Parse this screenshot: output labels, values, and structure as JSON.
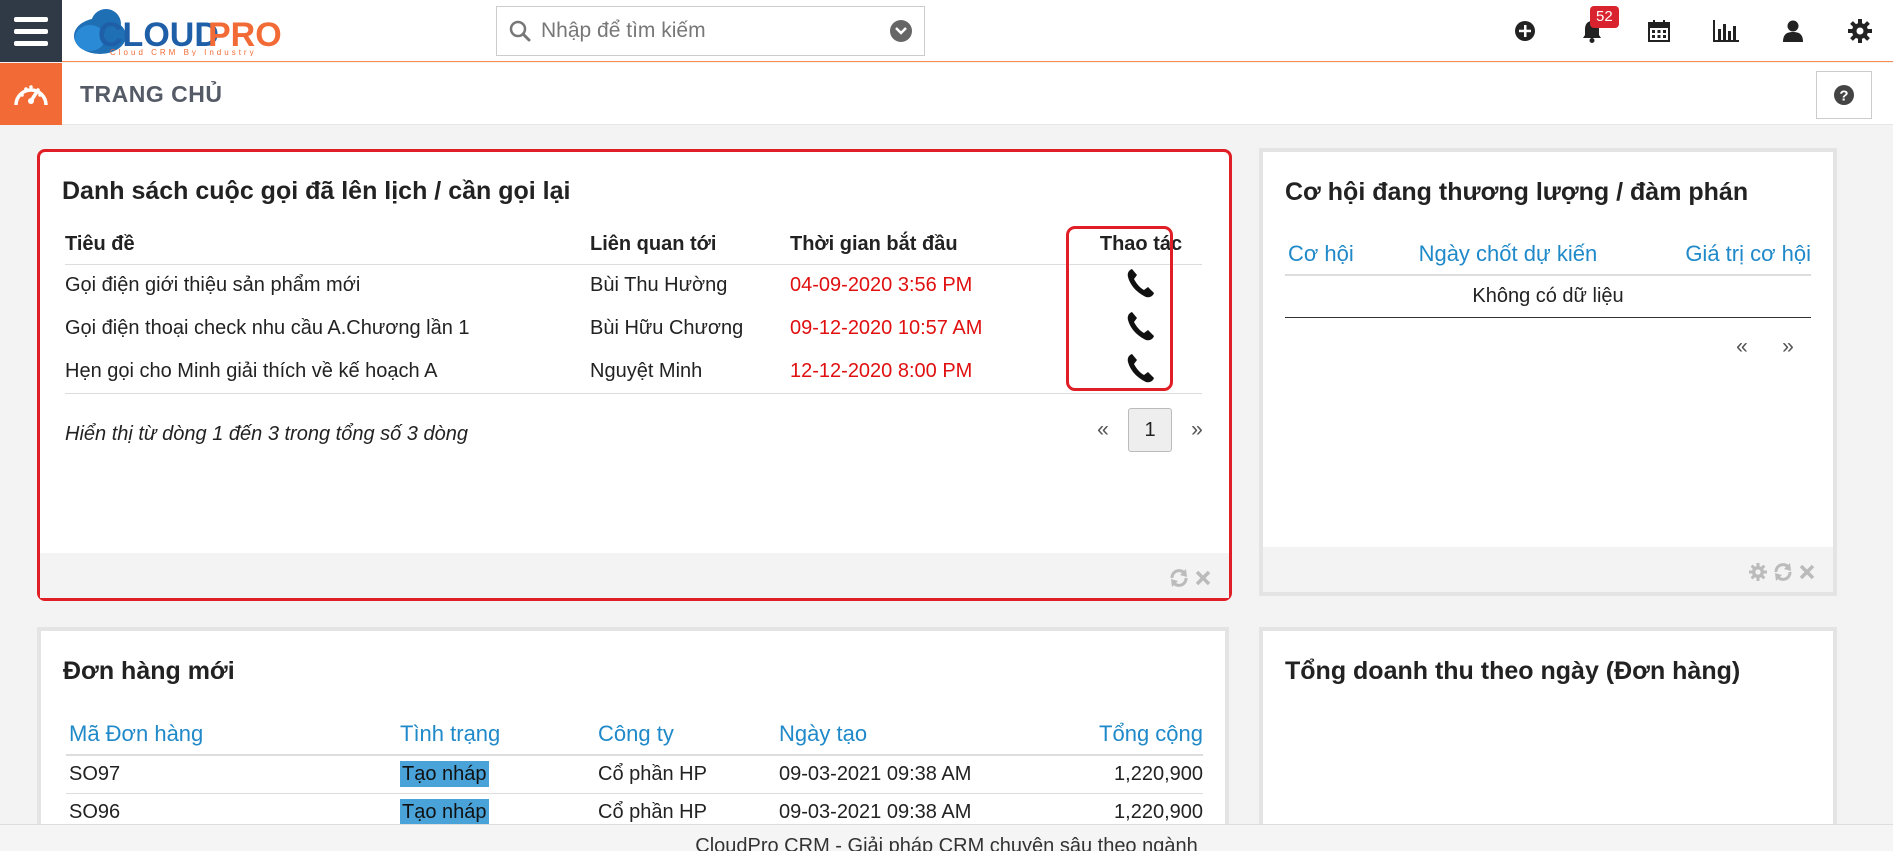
{
  "app": {
    "logo_text": "CLOUDPRO",
    "logo_tagline": "Cloud CRM By Industry"
  },
  "search": {
    "placeholder": "Nhập để tìm kiếm"
  },
  "notifications": {
    "count": "52"
  },
  "header": {
    "page_title": "TRANG CHỦ"
  },
  "calls_widget": {
    "title": "Danh sách cuộc gọi đã lên lịch / cần gọi lại",
    "columns": [
      "Tiêu đề",
      "Liên quan tới",
      "Thời gian bắt đầu",
      "Thao tác"
    ],
    "rows": [
      {
        "title": "Gọi điện giới thiệu sản phẩm mới",
        "related": "Bùi Thu Hường",
        "start": "04-09-2020 3:56 PM"
      },
      {
        "title": "Gọi điện thoại check nhu cầu A.Chương lần 1",
        "related": "Bùi Hữu Chương",
        "start": "09-12-2020 10:57 AM"
      },
      {
        "title": "Hẹn gọi cho Minh giải thích về kế hoạch A",
        "related": "Nguyệt Minh",
        "start": "12-12-2020 8:00 PM"
      }
    ],
    "summary": "Hiển thị từ dòng 1 đến 3 trong tổng số 3 dòng",
    "pager": {
      "prev": "«",
      "page": "1",
      "next": "»"
    }
  },
  "opportunities_widget": {
    "title": "Cơ hội đang thương lượng / đàm phán",
    "columns": [
      "Cơ hội",
      "Ngày chốt dự kiến",
      "Giá trị cơ hội"
    ],
    "empty_text": "Không có dữ liệu",
    "pager": {
      "prev": "«",
      "next": "»"
    }
  },
  "orders_widget": {
    "title": "Đơn hàng mới",
    "columns": [
      "Mã Đơn hàng",
      "Tình trạng",
      "Công ty",
      "Ngày tạo",
      "Tổng cộng"
    ],
    "rows": [
      {
        "code": "SO97",
        "status": "Tạo nháp",
        "company": "Cổ phần HP",
        "created": "09-03-2021 09:38 AM",
        "total": "1,220,900"
      },
      {
        "code": "SO96",
        "status": "Tạo nháp",
        "company": "Cổ phần HP",
        "created": "09-03-2021 09:38 AM",
        "total": "1,220,900"
      }
    ]
  },
  "revenue_widget": {
    "title": "Tổng doanh thu theo ngày (Đơn hàng)"
  },
  "footer": {
    "text": "CloudPro CRM - Giải pháp CRM chuyên sâu theo ngành"
  },
  "colors": {
    "accent_orange": "#f26b36",
    "link_blue": "#1f89c9",
    "highlight_red": "#e01e26",
    "status_blue": "#49a3d9"
  }
}
